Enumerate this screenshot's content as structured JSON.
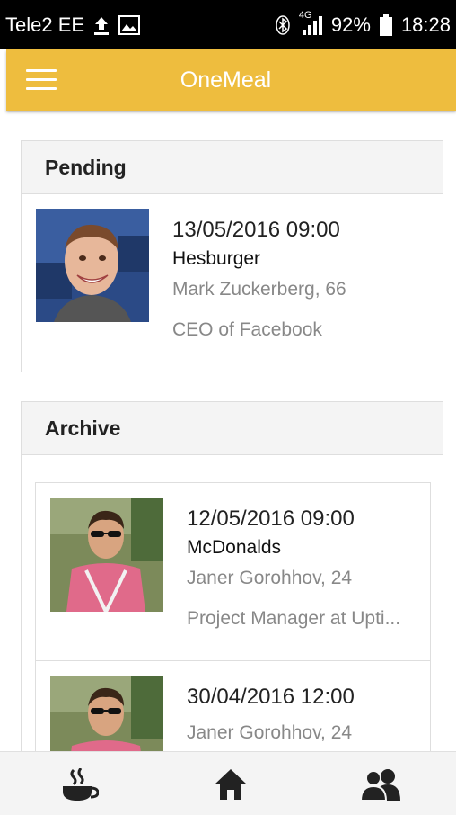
{
  "status_bar": {
    "carrier": "Tele2 EE",
    "network": "4G",
    "battery": "92%",
    "time": "18:28",
    "icons": [
      "upload-icon",
      "image-icon",
      "bluetooth-icon",
      "signal-icon",
      "battery-icon"
    ]
  },
  "app_bar": {
    "title": "OneMeal",
    "menu_icon": "hamburger-menu-icon"
  },
  "pending": {
    "title": "Pending",
    "items": [
      {
        "datetime": "13/05/2016 09:00",
        "place": "Hesburger",
        "person": "Mark Zuckerberg, 66",
        "description": "CEO of Facebook"
      }
    ]
  },
  "archive": {
    "title": "Archive",
    "items": [
      {
        "datetime": "12/05/2016 09:00",
        "place": "McDonalds",
        "person": "Janer Gorohhov, 24",
        "description": "Project Manager at Upti..."
      },
      {
        "datetime": "30/04/2016 12:00",
        "person": "Janer Gorohhov, 24"
      }
    ]
  },
  "bottom_nav": {
    "items": [
      {
        "icon": "coffee-cup-icon"
      },
      {
        "icon": "home-icon"
      },
      {
        "icon": "people-icon"
      }
    ]
  },
  "colors": {
    "app_bar": "#eebd3e",
    "status_bar": "#000000",
    "card_header": "#f4f4f4",
    "nav_icon": "#222222"
  }
}
